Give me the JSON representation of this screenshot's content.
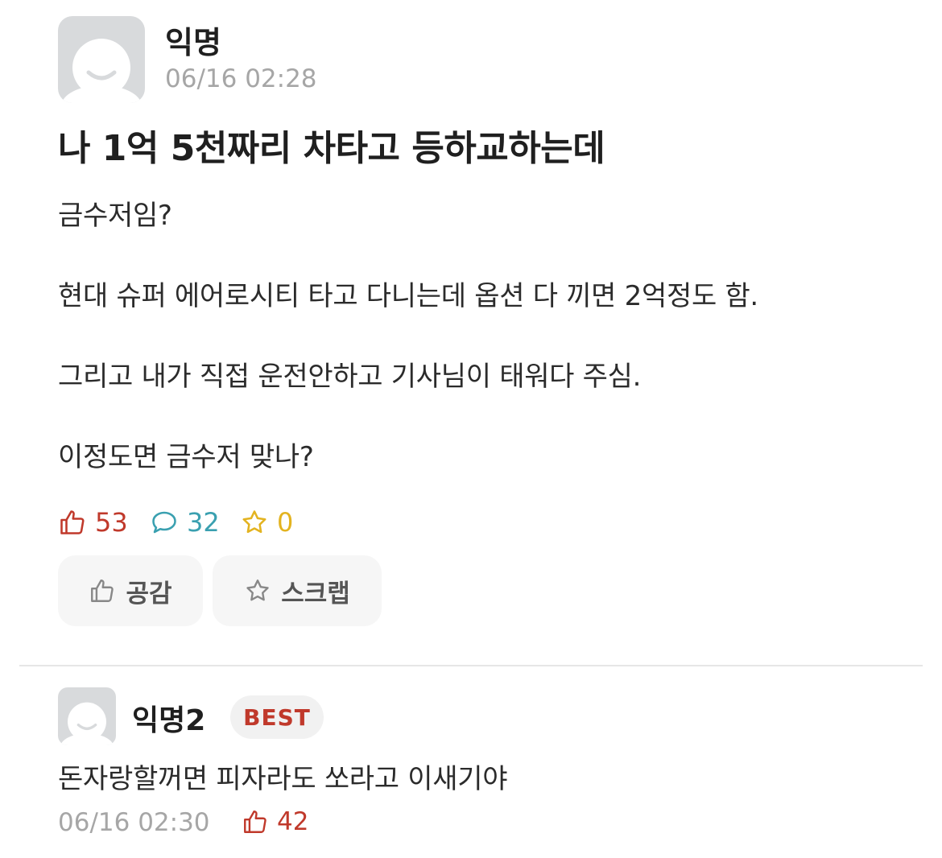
{
  "post": {
    "author": "익명",
    "timestamp": "06/16 02:28",
    "title": "나 1억 5천짜리 차타고 등하교하는데",
    "body": [
      "금수저임?",
      "현대 슈퍼 에어로시티 타고 다니는데 옵션 다 끼면 2억정도 함.",
      "그리고 내가 직접 운전안하고 기사님이 태워다 주심.",
      "이정도면 금수저 맞나?"
    ],
    "stats": {
      "likes": "53",
      "comments": "32",
      "scraps": "0"
    },
    "actions": {
      "like_label": "공감",
      "scrap_label": "스크랩"
    }
  },
  "comment": {
    "author": "익명2",
    "badge": "BEST",
    "text": "돈자랑할꺼면 피자라도 쏘라고 이새기야",
    "timestamp": "06/16 02:30",
    "likes": "42"
  },
  "colors": {
    "like": "#c0392b",
    "comment": "#3aa0b0",
    "scrap": "#e3b320",
    "time": "#a6a6a6"
  }
}
